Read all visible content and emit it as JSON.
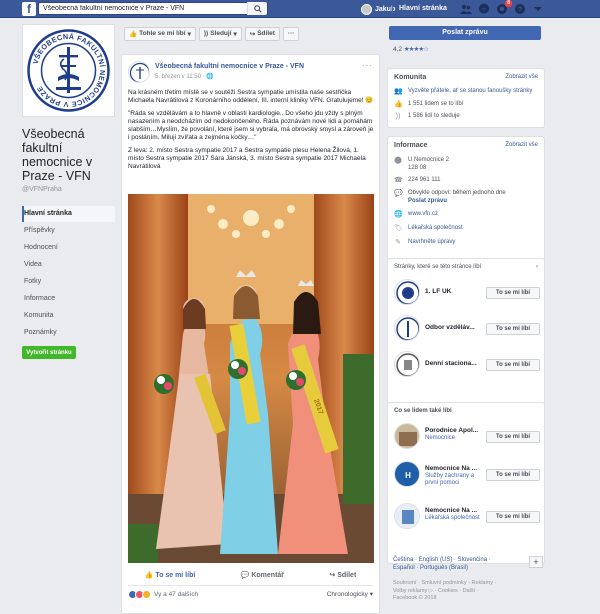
{
  "topbar": {
    "search_value": "Všeobecná fakultní nemocnice v Praze - VFN",
    "user_name": "Jakub",
    "home_label": "Hlavní stránka",
    "notification_count": "8"
  },
  "page": {
    "name": "Všeobecná fakultní nemocnice v Praze - VFN",
    "handle": "@VFNPraha",
    "logo_text": "VŠEOBECNÁ FAKULTNÍ NEMOCNICE V PRAZE"
  },
  "left_nav": {
    "items": [
      {
        "label": "Hlavní stránka"
      },
      {
        "label": "Příspěvky"
      },
      {
        "label": "Hodnocení"
      },
      {
        "label": "Videa"
      },
      {
        "label": "Fotky"
      },
      {
        "label": "Informace"
      },
      {
        "label": "Komunita"
      },
      {
        "label": "Poznámky"
      }
    ],
    "create_label": "Vytvořit stránku"
  },
  "action_bar": {
    "like_label": "Tohle se mi líbí",
    "follow_label": "Sledují",
    "share_label": "Sdílet",
    "more_label": "···"
  },
  "post": {
    "author": "Všeobecná fakultní nemocnice v Praze - VFN",
    "time": "5. březen v 11:50",
    "paragraphs": [
      "Na krásném třetím místě se v soutěži Sestra sympatie umístila naše sestřička Michaela Navrátilová z Koronárního oddělení, III. interní kliniky VFN. Gratulujeme! 😊",
      "\"Ráda se vzdělávám a to hlavně v oblasti kardiologie.. Do všeho jdu vždy s plným nasazením a neodcházím od nedokončeného. Ráda poznávám nové lidi a pomáhám slabším…Myslím, že povolání, které jsem si vybrala, má obrovský smysl a zároveň je i posláním. Miluji zvířata a zejména kočky…\"",
      "Z leva: 2. místo Sestra sympatie 2017 a Sestra sympatie plesu Helena Žilová, 1. místo Sestra sympatie 2017 Sára Jánská, 3. místo Sestra sympatie 2017 Michaela Navrátilová"
    ],
    "sash_text": "2017",
    "actions": {
      "like": "To se mi líbí",
      "comment": "Komentář",
      "share": "Sdílet"
    },
    "reactions": "Vy a 47 dalších",
    "sort": "Chronologicky ▾"
  },
  "sidebar": {
    "send_message": "Poslat zprávu",
    "rating_value": "4,2",
    "rating_stars": "★★★★☆",
    "community": {
      "title": "Komunita",
      "see_all": "Zobrazit vše",
      "invite": "Vyzvěte přátele, ať se stanou fanoušky stránky",
      "likes": "1 551 lidem se to líbí",
      "follows": "1 586 lidí to sleduje"
    },
    "info": {
      "title": "Informace",
      "see_all": "Zobrazit vše",
      "address1": "U Nemocnice 2",
      "address2": "128 08",
      "phone": "224 961 111",
      "response": "Obvykle odpoví: během jednoho dne",
      "send_msg": "Poslat zprávu",
      "web": "www.vfn.cz",
      "category": "Lékařská společnost",
      "suggest": "Navrhněte úpravy"
    },
    "liked_pages": {
      "title": "Stránky, které se této stránce líbí",
      "items": [
        {
          "name": "1. LF UK",
          "button": "To se mi líbí"
        },
        {
          "name": "Odbor vzděláv...",
          "button": "To se mi líbí"
        },
        {
          "name": "Denní staciona...",
          "button": "To se mi líbí"
        }
      ]
    },
    "also_liked": {
      "title": "Co se lidem také líbí",
      "items": [
        {
          "name": "Porodnice Apol...",
          "sub": "Nemocnice",
          "button": "To se mi líbí"
        },
        {
          "name": "Nemocnice Na ...",
          "sub": "Služby záchrany a první pomoci",
          "button": "To se mi líbí"
        },
        {
          "name": "Nemocnice Na ...",
          "sub": "Lékařská společnost",
          "button": "To se mi líbí"
        }
      ]
    },
    "languages": {
      "line1": "Čeština · English (US) · Slovenčina ·",
      "line2": "Español · Português (Brasil)"
    },
    "footer": {
      "line1": "Soukromí · Smluvní podmínky · Reklamy ·",
      "line2": "Volby reklamy ▷ · Cookies · Další ·",
      "line3": "Facebook © 2018"
    }
  },
  "colors": {
    "brand": "#3b5998",
    "accent": "#4267b2",
    "green": "#42b72a",
    "background": "#e9ebee"
  },
  "icons": [
    "facebook-logo-icon",
    "search-icon",
    "friends-icon",
    "messenger-icon",
    "notifications-icon",
    "help-icon",
    "dropdown-icon",
    "thumb-up-icon",
    "rss-icon",
    "share-icon",
    "pin-icon",
    "phone-icon",
    "chat-icon",
    "globe-icon",
    "tag-icon",
    "pencil-icon"
  ]
}
